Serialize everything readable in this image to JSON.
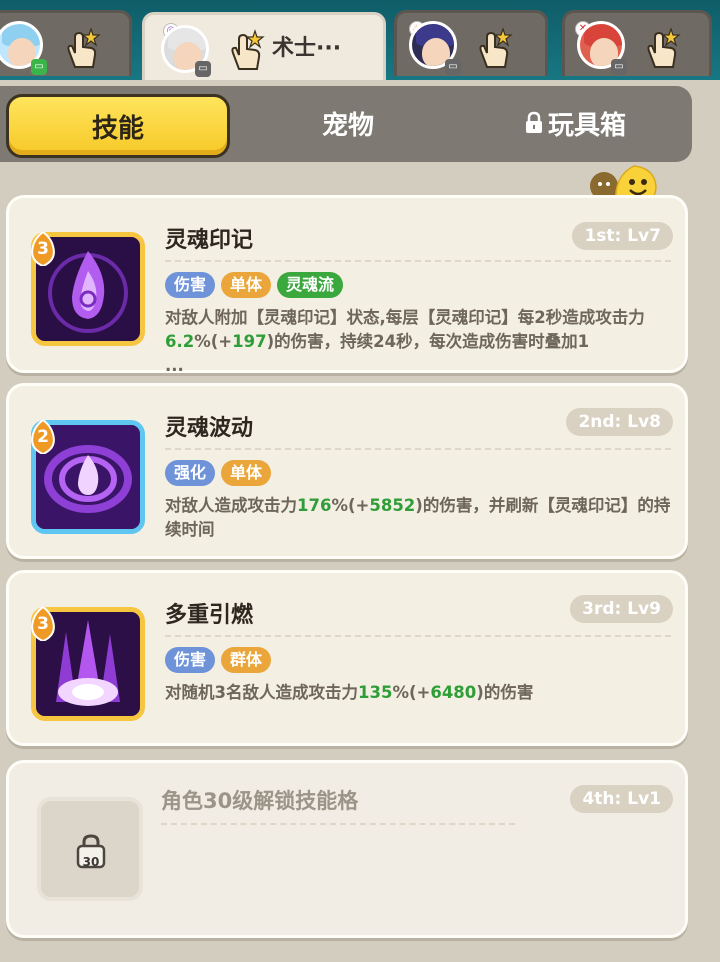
{
  "hero_tabs": [
    {
      "name": "",
      "element": "water",
      "status_color": "#3bb54a"
    },
    {
      "name": "术士···",
      "element": "soul",
      "status_color": "#666666"
    },
    {
      "name": "",
      "element": "fire",
      "status_color": "#666666"
    },
    {
      "name": "",
      "element": "wind",
      "status_color": "#666666"
    }
  ],
  "mode_tabs": {
    "skills": "技能",
    "pets": "宠物",
    "toybox": "玩具箱"
  },
  "chat_label": "聊天",
  "skills": [
    {
      "name": "灵魂印记",
      "slot": "1st: Lv7",
      "level": "3",
      "tags": [
        {
          "text": "伤害",
          "color": "blue"
        },
        {
          "text": "单体",
          "color": "orange"
        },
        {
          "text": "灵魂流",
          "color": "green"
        }
      ],
      "desc": {
        "part1": "对敌人附加【灵魂印记】状态,每层【灵魂印记】每2秒造成攻击力",
        "num1": "6.2",
        "part2": "%(+",
        "num2": "197",
        "part3": ")的伤害，持续24秒，每次造成伤害时叠加1",
        "more": "..."
      }
    },
    {
      "name": "灵魂波动",
      "slot": "2nd: Lv8",
      "level": "2",
      "tags": [
        {
          "text": "强化",
          "color": "blue"
        },
        {
          "text": "单体",
          "color": "orange"
        }
      ],
      "desc": {
        "part1": "对敌人造成攻击力",
        "num1": "176",
        "part2": "%(+",
        "num2": "5852",
        "part3": ")的伤害，并刷新【灵魂印记】的持续时间"
      }
    },
    {
      "name": "多重引燃",
      "slot": "3rd: Lv9",
      "level": "3",
      "tags": [
        {
          "text": "伤害",
          "color": "blue"
        },
        {
          "text": "群体",
          "color": "orange"
        }
      ],
      "desc": {
        "part1": "对随机3名敌人造成攻击力",
        "num1": "135",
        "part2": "%(+",
        "num2": "6480",
        "part3": ")的伤害"
      }
    }
  ],
  "locked_skill": {
    "text": "角色30级解锁技能格",
    "slot": "4th: Lv1",
    "unlock_level": "30"
  }
}
